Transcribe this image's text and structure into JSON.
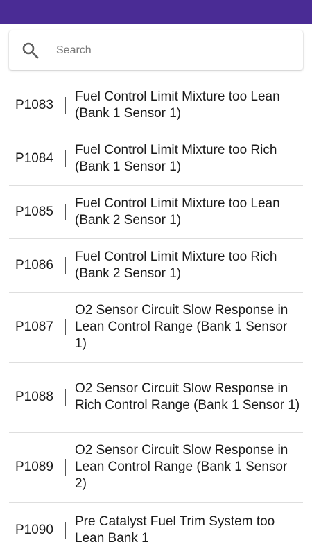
{
  "colors": {
    "statusbar": "#4a2c95"
  },
  "search": {
    "icon": "search-icon",
    "placeholder": "Search"
  },
  "codes": [
    {
      "code": "P1083",
      "description": "Fuel Control Limit Mixture too Lean (Bank 1 Sensor 1)"
    },
    {
      "code": "P1084",
      "description": "Fuel Control Limit Mixture too Rich (Bank 1 Sensor 1)"
    },
    {
      "code": "P1085",
      "description": "Fuel Control Limit Mixture too Lean (Bank 2 Sensor 1)"
    },
    {
      "code": "P1086",
      "description": "Fuel Control Limit Mixture too Rich (Bank 2 Sensor 1)"
    },
    {
      "code": "P1087",
      "description": "O2 Sensor Circuit Slow Response in Lean Control Range (Bank 1 Sensor 1)"
    },
    {
      "code": "P1088",
      "description": "O2 Sensor Circuit Slow Response in Rich Control Range (Bank 1 Sensor 1)"
    },
    {
      "code": "P1089",
      "description": "O2 Sensor Circuit Slow Response in Lean Control Range (Bank 1 Sensor 2)"
    },
    {
      "code": "P1090",
      "description": "Pre Catalyst Fuel Trim System too Lean Bank 1"
    }
  ]
}
